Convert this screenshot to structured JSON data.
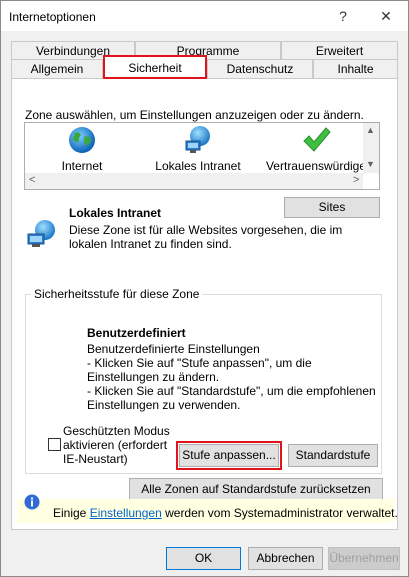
{
  "window": {
    "title": "Internetoptionen",
    "help_label": "?",
    "close_label": "✕"
  },
  "tabs": {
    "row_back": [
      "Verbindungen",
      "Programme",
      "Erweitert"
    ],
    "row_front": [
      "Allgemein",
      "Sicherheit",
      "Datenschutz",
      "Inhalte"
    ],
    "active": "Sicherheit"
  },
  "zone_section": {
    "instruction": "Zone auswählen, um Einstellungen anzuzeigen oder zu ändern.",
    "zones": [
      {
        "label": "Internet",
        "icon": "globe-icon"
      },
      {
        "label": "Lokales Intranet",
        "icon": "network-globe-icon"
      },
      {
        "label": "Vertrauenswürdige",
        "icon": "green-check-icon"
      }
    ],
    "scroll_left": "<",
    "scroll_right": ">"
  },
  "selected_zone": {
    "name": "Lokales Intranet",
    "description": "Diese Zone ist für alle Websites vorgesehen, die im lokalen Intranet zu finden sind.",
    "sites_button": "Sites"
  },
  "security_level": {
    "group_title": "Sicherheitsstufe für diese Zone",
    "level_name": "Benutzerdefiniert",
    "line1": "Benutzerdefinierte Einstellungen",
    "line2": "- Klicken Sie auf \"Stufe anpassen\", um die Einstellungen zu ändern.",
    "line3": "- Klicken Sie auf \"Standardstufe\", um die empfohlenen Einstellungen zu verwenden.",
    "protected_mode_label": "Geschützten Modus aktivieren (erfordert IE-Neustart)",
    "protected_mode_checked": false,
    "custom_level_button": "Stufe anpassen...",
    "default_level_button": "Standardstufe"
  },
  "reset_all_button": "Alle Zonen auf Standardstufe zurücksetzen",
  "info_bar": {
    "prefix": "Einige ",
    "link": "Einstellungen",
    "suffix": " werden vom Systemadministrator verwaltet."
  },
  "footer": {
    "ok": "OK",
    "cancel": "Abbrechen",
    "apply": "Übernehmen"
  },
  "colors": {
    "highlight_red": "#e2141b",
    "link_blue": "#0066cc",
    "info_bg": "#ffffe1"
  }
}
